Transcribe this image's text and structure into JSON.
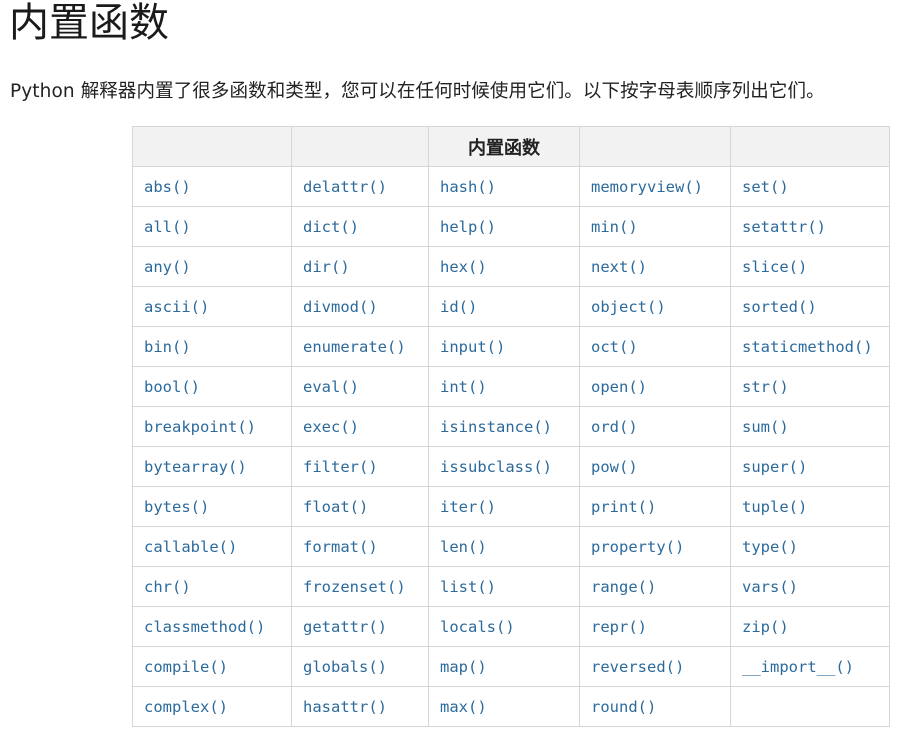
{
  "page": {
    "title": "内置函数",
    "intro": "Python 解释器内置了很多函数和类型，您可以在任何时候使用它们。以下按字母表顺序列出它们。"
  },
  "table": {
    "header": [
      "",
      "",
      "内置函数",
      "",
      ""
    ],
    "rows": [
      [
        "abs()",
        "delattr()",
        "hash()",
        "memoryview()",
        "set()"
      ],
      [
        "all()",
        "dict()",
        "help()",
        "min()",
        "setattr()"
      ],
      [
        "any()",
        "dir()",
        "hex()",
        "next()",
        "slice()"
      ],
      [
        "ascii()",
        "divmod()",
        "id()",
        "object()",
        "sorted()"
      ],
      [
        "bin()",
        "enumerate()",
        "input()",
        "oct()",
        "staticmethod()"
      ],
      [
        "bool()",
        "eval()",
        "int()",
        "open()",
        "str()"
      ],
      [
        "breakpoint()",
        "exec()",
        "isinstance()",
        "ord()",
        "sum()"
      ],
      [
        "bytearray()",
        "filter()",
        "issubclass()",
        "pow()",
        "super()"
      ],
      [
        "bytes()",
        "float()",
        "iter()",
        "print()",
        "tuple()"
      ],
      [
        "callable()",
        "format()",
        "len()",
        "property()",
        "type()"
      ],
      [
        "chr()",
        "frozenset()",
        "list()",
        "range()",
        "vars()"
      ],
      [
        "classmethod()",
        "getattr()",
        "locals()",
        "repr()",
        "zip()"
      ],
      [
        "compile()",
        "globals()",
        "map()",
        "reversed()",
        "__import__()"
      ],
      [
        "complex()",
        "hasattr()",
        "max()",
        "round()",
        ""
      ]
    ]
  },
  "colors": {
    "link": "#2c6a9c",
    "header_bg": "#f2f2f2",
    "border": "#d6d6d6"
  }
}
